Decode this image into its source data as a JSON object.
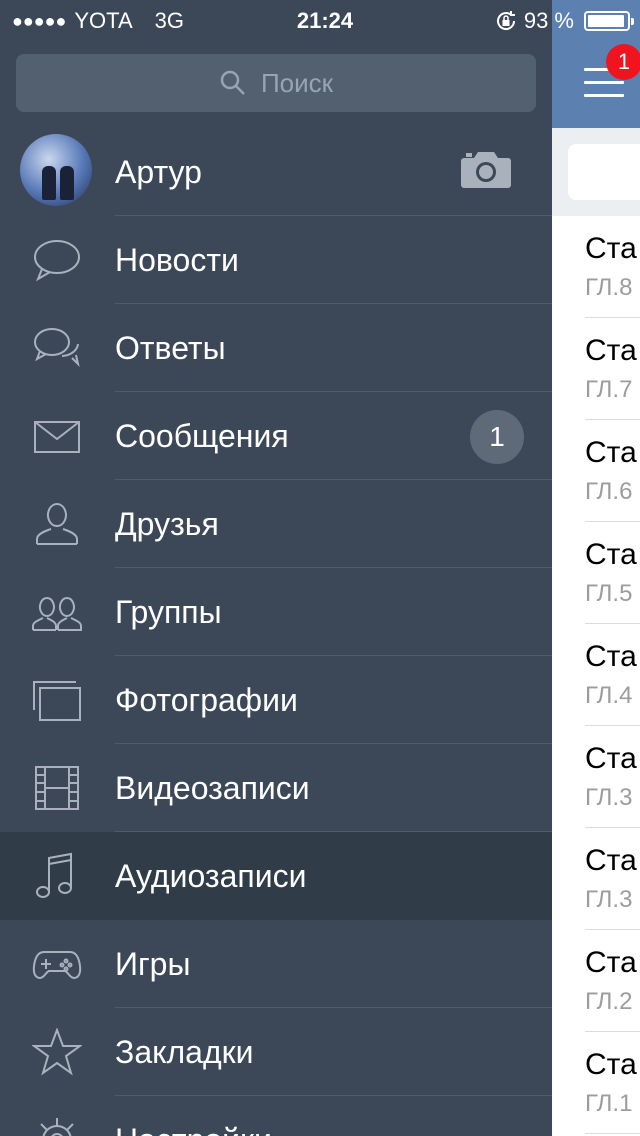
{
  "status_bar": {
    "signal": "●●●●●",
    "carrier": "YOTA",
    "network": "3G",
    "time": "21:24",
    "battery_text": "93 %"
  },
  "search": {
    "placeholder": "Поиск"
  },
  "menu": {
    "profile": {
      "name": "Артур"
    },
    "items": [
      {
        "label": "Новости",
        "icon": "news-bubble-icon"
      },
      {
        "label": "Ответы",
        "icon": "replies-bubbles-icon"
      },
      {
        "label": "Сообщения",
        "icon": "envelope-icon",
        "badge": "1"
      },
      {
        "label": "Друзья",
        "icon": "person-icon"
      },
      {
        "label": "Группы",
        "icon": "people-icon"
      },
      {
        "label": "Фотографии",
        "icon": "photos-icon"
      },
      {
        "label": "Видеозаписи",
        "icon": "film-icon"
      },
      {
        "label": "Аудиозаписи",
        "icon": "music-note-icon",
        "active": true
      },
      {
        "label": "Игры",
        "icon": "gamepad-icon"
      },
      {
        "label": "Закладки",
        "icon": "star-icon"
      },
      {
        "label": "Настройки",
        "icon": "gear-icon"
      }
    ]
  },
  "content": {
    "notification_count": "1",
    "rows": [
      {
        "title": "Ста",
        "subtitle": "ГЛ.8"
      },
      {
        "title": "Ста",
        "subtitle": "ГЛ.7"
      },
      {
        "title": "Ста",
        "subtitle": "ГЛ.6"
      },
      {
        "title": "Ста",
        "subtitle": "ГЛ.5"
      },
      {
        "title": "Ста",
        "subtitle": "ГЛ.4"
      },
      {
        "title": "Ста",
        "subtitle": "ГЛ.3"
      },
      {
        "title": "Ста",
        "subtitle": "ГЛ.3"
      },
      {
        "title": "Ста",
        "subtitle": "ГЛ.2"
      },
      {
        "title": "Ста",
        "subtitle": "ГЛ.1"
      }
    ]
  },
  "colors": {
    "drawer_bg": "#3c4858",
    "active_item_bg": "#313c49",
    "header_blue": "#5c81b0",
    "notification_red": "#f0141e"
  }
}
